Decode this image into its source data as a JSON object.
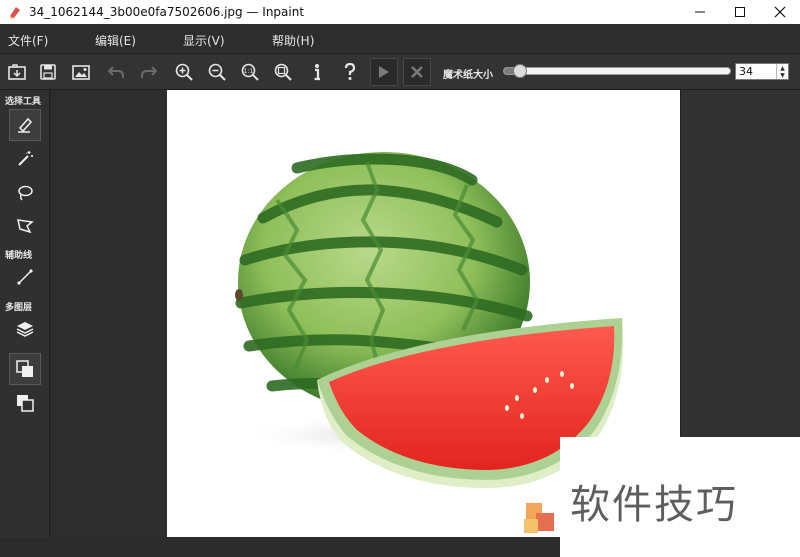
{
  "window": {
    "title": "34_1062144_3b00e0fa7502606.jpg — Inpaint",
    "controls": [
      "minimize",
      "maximize",
      "close"
    ]
  },
  "menu": {
    "items": [
      "文件(F)",
      "编辑(E)",
      "显示(V)",
      "帮助(H)"
    ]
  },
  "toolbar": {
    "buttons": [
      "open-icon",
      "save-icon",
      "image-icon",
      "undo-icon",
      "redo-icon",
      "zoom-in-icon",
      "zoom-out-icon",
      "zoom-actual-icon",
      "zoom-fit-icon",
      "info-icon",
      "help-icon",
      "run-icon",
      "cancel-icon"
    ],
    "brush_label": "魔术纸大小",
    "brush_size": "34",
    "brush_fraction": 0.07
  },
  "sidebar": {
    "sections": [
      {
        "label": "选择工具",
        "tools": [
          "marker-icon",
          "magic-wand-icon",
          "lasso-icon",
          "polygon-lasso-icon"
        ]
      },
      {
        "label": "辅助线",
        "tools": [
          "guide-line-icon"
        ]
      },
      {
        "label": "多图层",
        "tools": [
          "layers-icon",
          "layer-stack-front-icon",
          "layer-stack-back-icon"
        ]
      }
    ]
  },
  "watermark": {
    "text": "软件技巧"
  },
  "colors": {
    "background": "#2b2b2b",
    "panel": "#333333",
    "accent_red": "#e53935",
    "melon_green": "#3c8b2e"
  }
}
